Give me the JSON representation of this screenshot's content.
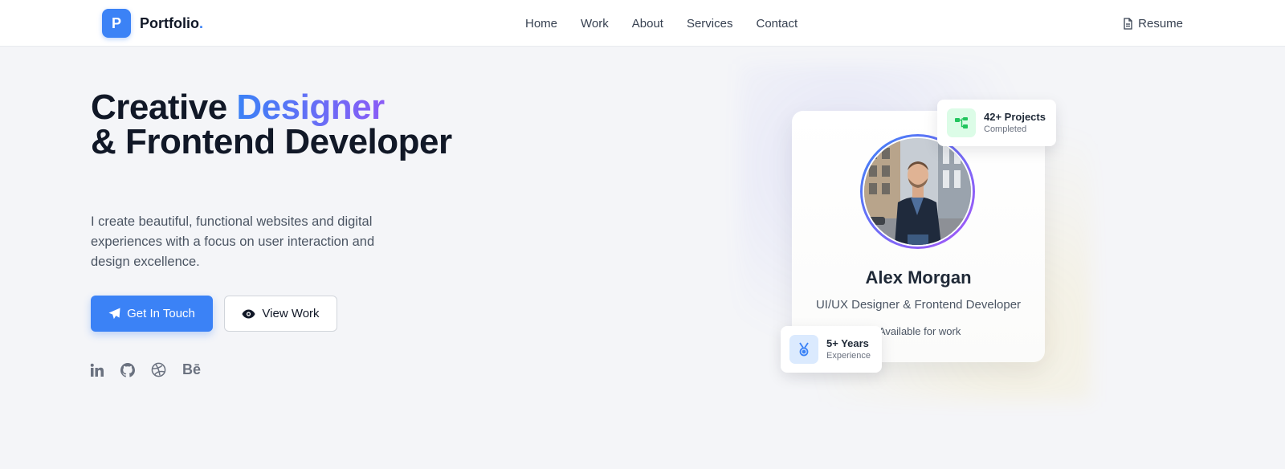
{
  "nav": {
    "brand_initial": "P",
    "brand_name": "Portfolio",
    "brand_dot": ".",
    "links": [
      "Home",
      "Work",
      "About",
      "Services",
      "Contact"
    ],
    "resume_label": "Resume"
  },
  "hero": {
    "title_part1": "Creative ",
    "title_highlight": "Designer",
    "title_part2": "& Frontend Developer",
    "description": "I create beautiful, functional websites and digital experiences with a focus on user interaction and design excellence.",
    "primary_button": "Get In Touch",
    "secondary_button": "View Work",
    "socials": [
      {
        "icon": "linkedin-icon"
      },
      {
        "icon": "github-icon"
      },
      {
        "icon": "dribbble-icon"
      },
      {
        "icon": "behance-icon",
        "text": "Bē"
      }
    ]
  },
  "profile": {
    "name": "Alex Morgan",
    "role": "UI/UX Designer & Frontend Developer",
    "status": "Available for work",
    "stats": [
      {
        "value": "42+ Projects",
        "label": "Completed",
        "icon": "project-tree-icon"
      },
      {
        "value": "5+ Years",
        "label": "Experience",
        "icon": "medal-icon"
      }
    ]
  },
  "colors": {
    "accent": "#3b82f6",
    "gradient_end": "#8b5cf6",
    "background": "#f4f5f8",
    "text": "#111827"
  }
}
